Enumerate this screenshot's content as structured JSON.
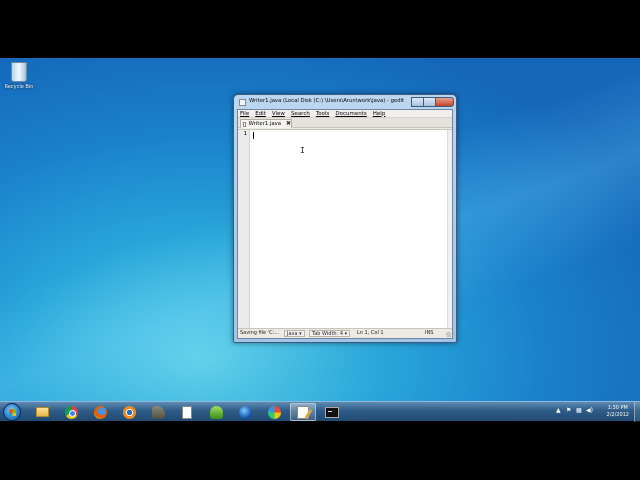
{
  "desktop": {
    "icons": [
      {
        "label": "Recycle Bin",
        "icon": "recycle-bin-icon"
      }
    ]
  },
  "window": {
    "title": "Writer1.java (Local Disk (C:) \\Users\\Arun\\work\\java) - gedit",
    "menu": [
      "File",
      "Edit",
      "View",
      "Search",
      "Tools",
      "Documents",
      "Help"
    ],
    "tab": {
      "label": "Writer1.java",
      "close_icon": "close-icon"
    },
    "editor": {
      "line_numbers": [
        "1"
      ],
      "content": ""
    },
    "status": {
      "message": "Saving file 'C:...",
      "language": "Java",
      "tab_width": "Tab Width: 4",
      "position": "Ln 1, Col 1",
      "mode": "INS"
    }
  },
  "taskbar": {
    "pinned": [
      {
        "name": "windows-explorer",
        "icon": "folder-icon"
      },
      {
        "name": "google-chrome",
        "icon": "chrome-icon"
      },
      {
        "name": "firefox",
        "icon": "firefox-icon"
      },
      {
        "name": "blender",
        "icon": "blender-icon"
      },
      {
        "name": "gimp",
        "icon": "gimp-icon"
      },
      {
        "name": "document",
        "icon": "document-icon"
      },
      {
        "name": "inkscape",
        "icon": "inkscape-icon"
      },
      {
        "name": "globe-app",
        "icon": "globe-icon"
      },
      {
        "name": "paint-app",
        "icon": "palette-icon"
      },
      {
        "name": "gedit",
        "icon": "gedit-icon",
        "active": true
      },
      {
        "name": "command-prompt",
        "icon": "terminal-icon"
      }
    ],
    "clock": {
      "time": "1:30 PM",
      "date": "2/2/2012"
    }
  },
  "colors": {
    "taskbar": "#2f5d88",
    "desktop_light": "#5fd0e8",
    "desktop_dark": "#1565b8",
    "window_frame": "#a3c4e6",
    "close_button": "#c4442c"
  }
}
